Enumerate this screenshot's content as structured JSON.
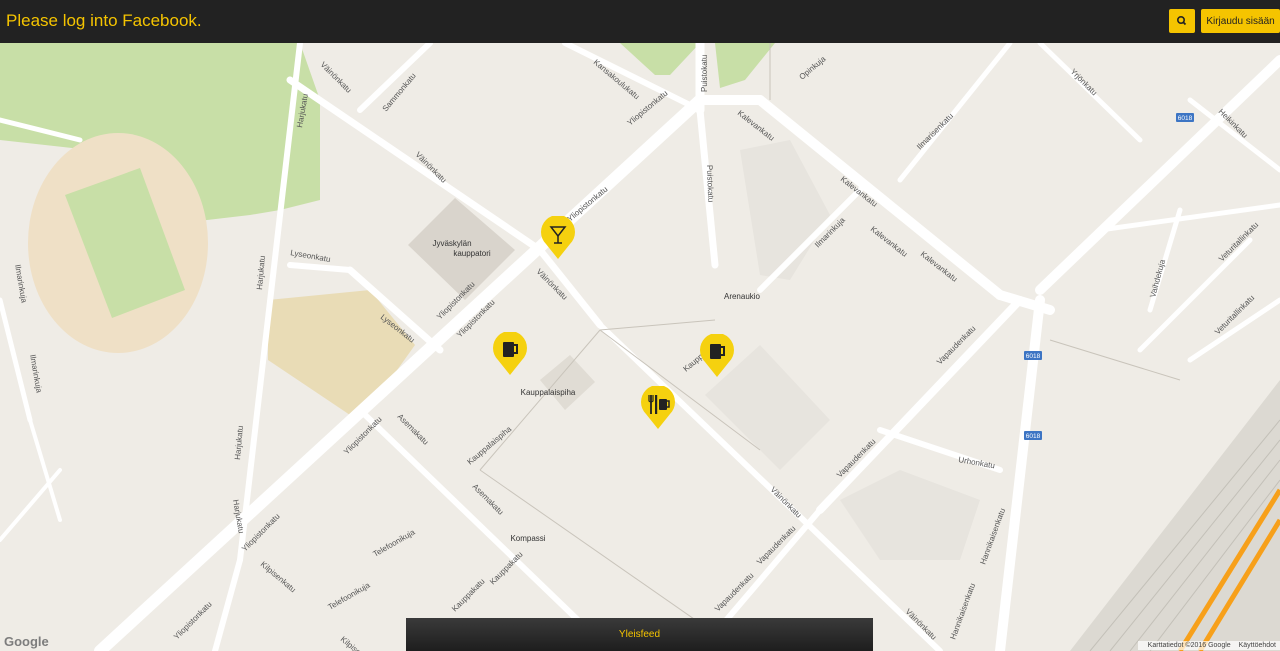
{
  "header": {
    "title": "Please log into Facebook.",
    "search_icon": "search-icon",
    "login_label": "Kirjaudu sisään"
  },
  "colors": {
    "accent": "#f5c400",
    "header_bg": "#222222",
    "map_bg": "#efece6",
    "park": "#c8dfa7",
    "road": "#ffffff",
    "rail": "#f7a01a"
  },
  "map": {
    "streets": {
      "vainonkatu": "Väinönkatu",
      "sammonkatu": "Sammonkatu",
      "kansakoulukatu": "Kansakoulukatu",
      "puistokatu": "Puistokatu",
      "opinkuja": "Opinkuja",
      "yliopistonkatu": "Yliopistonkatu",
      "kalevankatu": "Kalevankatu",
      "harjukatu": "Harjukatu",
      "lyseonkatu": "Lyseonkatu",
      "ilmarisenkatu": "Ilmarisenkatu",
      "yrjonkatu": "Yrjönkatu",
      "heikinkatu": "Heikinkatu",
      "vapaudenkatu": "Vapaudenkatu",
      "urhonkatu": "Urhonkatu",
      "asemakatu": "Asemakatu",
      "kauppakatu": "Kauppakatu",
      "kauppalaispiha_street": "Kauppalaispiha",
      "kilpisenkatu": "Kilpisenkatu",
      "telefoonikuja": "Telefoonikuja",
      "hannikaisenkatu": "Hannikaisenkatu",
      "ilmarinkuja": "Ilmarinkuja",
      "vaihdekuja": "Vaihdekuja",
      "veturitallinkatu": "Veturitallinkatu",
      "kauppa_short": "Kaupp"
    },
    "places": {
      "kauppatori_line1": "Jyväskylän",
      "kauppatori_line2": "kauppatori",
      "arenaukio": "Arenaukio",
      "kauppalaispiha": "Kauppalaispiha",
      "kompassi": "Kompassi"
    },
    "route_badges": {
      "r1": "6018",
      "r2": "6018",
      "r3": "6018"
    },
    "markers": [
      {
        "type": "cocktail",
        "icon": "cocktail-icon"
      },
      {
        "type": "beer",
        "icon": "beer-mug-icon"
      },
      {
        "type": "beer",
        "icon": "beer-mug-icon"
      },
      {
        "type": "restaurant",
        "icon": "fork-knife-icon"
      }
    ]
  },
  "footer": {
    "feed_label": "Yleisfeed",
    "google_logo": "Google",
    "attribution": "Karttatiedot ©2016 Google",
    "terms": "Käyttöehdot"
  }
}
